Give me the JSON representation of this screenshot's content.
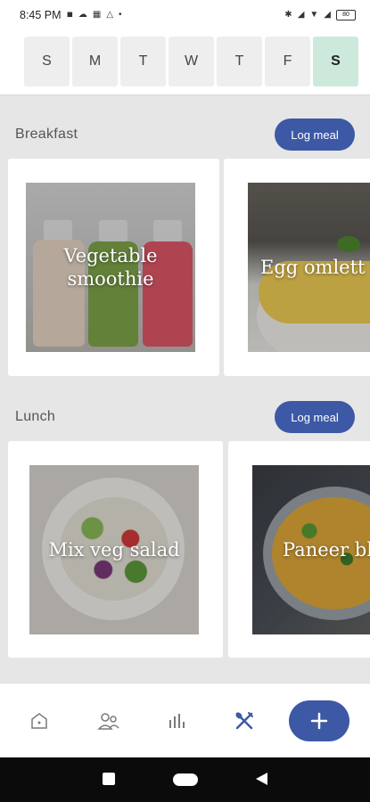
{
  "status_bar": {
    "time": "8:45 PM",
    "battery": "80"
  },
  "week": {
    "days": [
      "S",
      "M",
      "T",
      "W",
      "T",
      "F",
      "S"
    ],
    "selected_index": 6
  },
  "sections": [
    {
      "title": "Breakfast",
      "log_label": "Log meal",
      "meals": [
        {
          "name": "Vegetable\nsmoothie"
        },
        {
          "name": "Egg omlett"
        }
      ]
    },
    {
      "title": "Lunch",
      "log_label": "Log meal",
      "meals": [
        {
          "name": "Mix veg salad"
        },
        {
          "name": "Paneer bhu"
        }
      ]
    }
  ],
  "bottom_nav": {
    "items": [
      "home-icon",
      "people-icon",
      "chart-icon",
      "fork-knife-icon"
    ],
    "active": "fork-knife-icon",
    "fab_label": "+"
  },
  "colors": {
    "accent": "#3d59a5",
    "day_selected": "#cde9dc",
    "active_nav": "#3d59a5"
  }
}
